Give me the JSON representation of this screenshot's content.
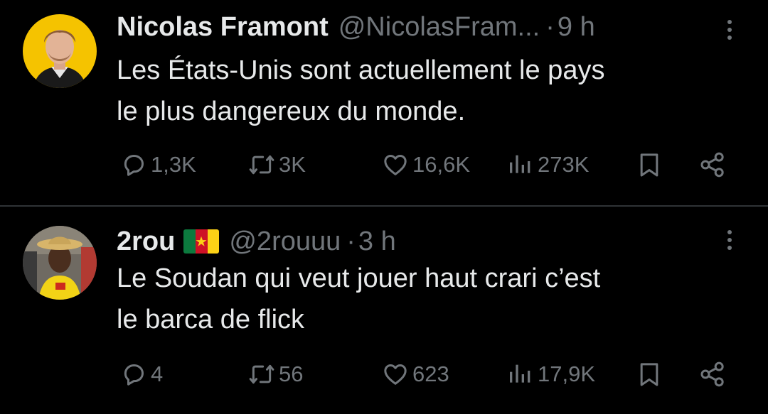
{
  "tweets": [
    {
      "display_name": "Nicolas Framont",
      "handle": "@NicolasFram...",
      "separator": "·",
      "time": "9 h",
      "text_lines": [
        "Les États-Unis sont actuellement le pays",
        "le plus dangereux du monde."
      ],
      "stats": {
        "replies": "1,3K",
        "reposts": "3K",
        "likes": "16,6K",
        "views": "273K"
      },
      "avatar_bg": "#f5c300"
    },
    {
      "display_name": "2rou",
      "has_flag": "Cameroon",
      "handle": "@2rouuu",
      "separator": "·",
      "time": "3 h",
      "text_lines": [
        "Le Soudan qui veut jouer haut crari c’est",
        "le barca de flick"
      ],
      "stats": {
        "replies": "4",
        "reposts": "56",
        "likes": "623",
        "views": "17,9K"
      }
    }
  ],
  "colors": {
    "background": "#000000",
    "text": "#e7e9ea",
    "muted": "#71767b",
    "divider": "#2f3336"
  },
  "icons": [
    "reply-icon",
    "repost-icon",
    "like-icon",
    "views-icon",
    "bookmark-icon",
    "share-icon",
    "more-icon"
  ]
}
